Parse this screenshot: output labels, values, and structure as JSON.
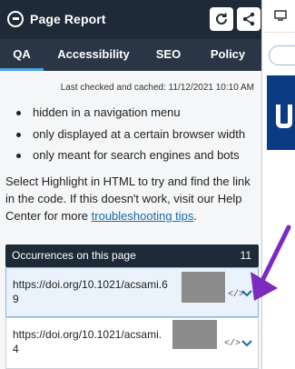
{
  "app": {
    "title": "Page Report"
  },
  "tabs": [
    {
      "label": "QA",
      "active": true
    },
    {
      "label": "Accessibility",
      "active": false
    },
    {
      "label": "SEO",
      "active": false
    },
    {
      "label": "Policy",
      "active": false
    }
  ],
  "cached_text": "Last checked and cached: 11/12/2021 10:10 AM",
  "reasons": [
    "hidden in a navigation menu",
    "only displayed at a certain browser width",
    "only meant for search engines and bots"
  ],
  "help": {
    "text": "Select Highlight in HTML to try and find the link in the code. If this doesn't work, visit our Help Center for more ",
    "link_text": "troubleshooting tips",
    "suffix": "."
  },
  "occurrences": {
    "title": "Occurrences on this page",
    "count": "11",
    "rows": [
      {
        "url": "https://doi.org/10.1021/acsami.6",
        "line": "9"
      },
      {
        "url": "https://doi.org/10.1021/acsami.",
        "line": "4"
      }
    ]
  },
  "icons": {
    "logo": "monsido-logo-icon",
    "refresh": "refresh-icon",
    "share": "share-icon",
    "code": "code-icon",
    "expand": "chevron-down-icon",
    "annotation": "purple-arrow"
  },
  "colors": {
    "topbar": "#1f2a38",
    "tabbar": "#2a3646",
    "active_tab_underline": "#4aa3df",
    "link": "#1a6aa8",
    "annotation_arrow": "#7b2cbf",
    "redaction": "#8c8c8c"
  }
}
